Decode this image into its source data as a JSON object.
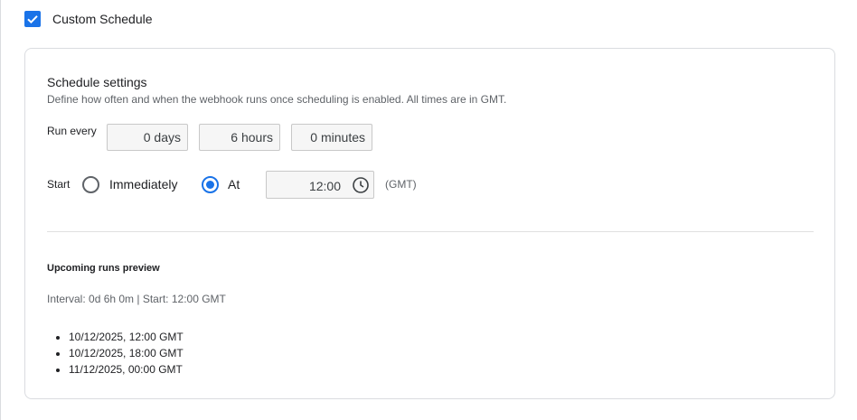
{
  "custom_schedule": {
    "label": "Custom Schedule",
    "checked": true
  },
  "settings": {
    "title": "Schedule settings",
    "description": "Define how often and when the webhook runs once scheduling is enabled. All times are in GMT.",
    "run_every_label": "Run every",
    "days": "0 days",
    "hours": "6 hours",
    "minutes": "0 minutes",
    "start_label": "Start",
    "immediately_label": "Immediately",
    "at_label": "At",
    "selected_start": "At",
    "time_value": "12:00",
    "timezone_note": "(GMT)"
  },
  "preview": {
    "title": "Upcoming runs preview",
    "interval_text": "Interval: 0d 6h 0m | Start: 12:00 GMT",
    "runs": [
      "10/12/2025, 12:00 GMT",
      "10/12/2025, 18:00 GMT",
      "11/12/2025, 00:00 GMT"
    ]
  },
  "colors": {
    "accent": "#1a73e8",
    "border": "#dadce0",
    "muted_text": "#5f6368"
  }
}
